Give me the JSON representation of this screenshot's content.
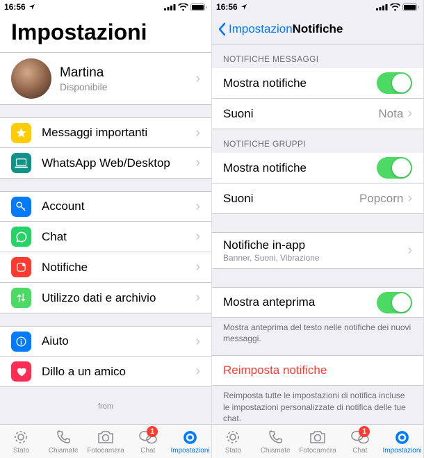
{
  "status": {
    "time": "16:56",
    "locArrow": true
  },
  "left": {
    "title": "Impostazioni",
    "profile": {
      "name": "Martina",
      "status": "Disponibile"
    },
    "g1": [
      {
        "label": "Messaggi importanti",
        "icon": "star",
        "bg": "#ffcc00"
      },
      {
        "label": "WhatsApp Web/Desktop",
        "icon": "laptop",
        "bg": "#0f9288"
      }
    ],
    "g2": [
      {
        "label": "Account",
        "icon": "key",
        "bg": "#007aff"
      },
      {
        "label": "Chat",
        "icon": "wa",
        "bg": "#25d366"
      },
      {
        "label": "Notifiche",
        "icon": "bell",
        "bg": "#ff3b30"
      },
      {
        "label": "Utilizzo dati e archivio",
        "icon": "updown",
        "bg": "#4cd964"
      }
    ],
    "g3": [
      {
        "label": "Aiuto",
        "icon": "info",
        "bg": "#007aff"
      },
      {
        "label": "Dillo a un amico",
        "icon": "heart",
        "bg": "#ff2d55"
      }
    ],
    "from": "from"
  },
  "right": {
    "back": "Impostazioni",
    "title": "Notifiche",
    "s1_header": "NOTIFICHE MESSAGGI",
    "s1": {
      "show": "Mostra notifiche",
      "sounds": "Suoni",
      "soundsVal": "Nota"
    },
    "s2_header": "NOTIFICHE GRUPPI",
    "s2": {
      "show": "Mostra notifiche",
      "sounds": "Suoni",
      "soundsVal": "Popcorn"
    },
    "s3": {
      "label": "Notifiche in-app",
      "sub": "Banner, Suoni, Vibrazione"
    },
    "s4": {
      "label": "Mostra anteprima",
      "footer": "Mostra anteprima del testo nelle notifiche dei nuovi messaggi."
    },
    "s5": {
      "label": "Reimposta notifiche",
      "footer": "Reimposta tutte le impostazioni di notifica incluse le impostazioni personalizzate di notifica delle tue chat."
    }
  },
  "tabs": {
    "stato": "Stato",
    "chiamate": "Chiamate",
    "fotocamera": "Fotocamera",
    "chat": "Chat",
    "chatBadge": "1",
    "impostazioni": "Impostazioni"
  }
}
